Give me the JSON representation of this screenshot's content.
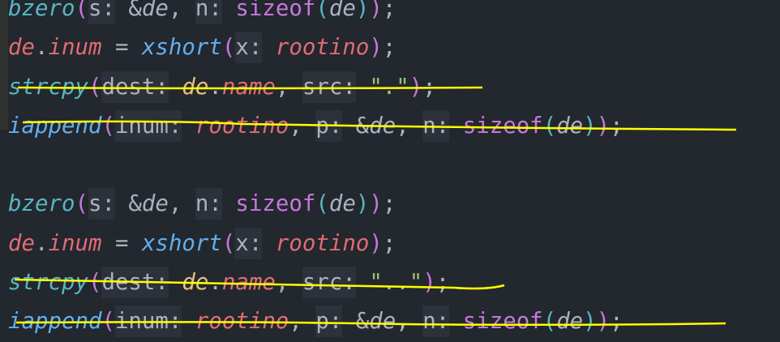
{
  "colors": {
    "background": "#23272e",
    "variable": "#e06c75",
    "function": "#61afef",
    "builtin_function": "#56b6c2",
    "paren": "#c678dd",
    "member_base": "#e5c07b",
    "string": "#98c379",
    "plain": "#abb2bf",
    "hint_bg": "#2c313a",
    "annotation": "#ffff00"
  },
  "lines": [
    [
      {
        "t": "bzero",
        "c": "builtin_function",
        "i": true
      },
      {
        "t": "(",
        "c": "paren"
      },
      {
        "t": "s:",
        "h": true
      },
      {
        "t": " &"
      },
      {
        "t": "de",
        "i": true
      },
      {
        "t": ", "
      },
      {
        "t": "n:",
        "h": true
      },
      {
        "t": " "
      },
      {
        "t": "sizeof",
        "c": "paren"
      },
      {
        "t": "(",
        "c": "builtin_function"
      },
      {
        "t": "de",
        "i": true
      },
      {
        "t": ")",
        "c": "builtin_function"
      },
      {
        "t": ")",
        "c": "paren"
      },
      {
        "t": ";"
      }
    ],
    [
      {
        "t": "de",
        "c": "variable",
        "i": true
      },
      {
        "t": "."
      },
      {
        "t": "inum",
        "c": "variable",
        "i": true
      },
      {
        "t": " = "
      },
      {
        "t": "xshort",
        "c": "function",
        "i": true
      },
      {
        "t": "(",
        "c": "paren"
      },
      {
        "t": "x:",
        "h": true
      },
      {
        "t": " "
      },
      {
        "t": "rootino",
        "c": "variable",
        "i": true
      },
      {
        "t": ")",
        "c": "paren"
      },
      {
        "t": ";"
      }
    ],
    [
      {
        "t": "strcpy",
        "c": "builtin_function",
        "i": true
      },
      {
        "t": "(",
        "c": "paren"
      },
      {
        "t": "dest:",
        "h": true
      },
      {
        "t": " "
      },
      {
        "t": "de",
        "c": "member_base",
        "i": true
      },
      {
        "t": "."
      },
      {
        "t": "name",
        "c": "variable",
        "i": true
      },
      {
        "t": ", "
      },
      {
        "t": "src:",
        "h": true
      },
      {
        "t": " "
      },
      {
        "t": "\".\"",
        "c": "string"
      },
      {
        "t": ")",
        "c": "paren"
      },
      {
        "t": ";"
      }
    ],
    [
      {
        "t": "iappend",
        "c": "function",
        "i": true
      },
      {
        "t": "(",
        "c": "paren"
      },
      {
        "t": "inum:",
        "h": true
      },
      {
        "t": " "
      },
      {
        "t": "rootino",
        "c": "variable",
        "i": true
      },
      {
        "t": ", "
      },
      {
        "t": "p:",
        "h": true
      },
      {
        "t": " &"
      },
      {
        "t": "de",
        "i": true
      },
      {
        "t": ", "
      },
      {
        "t": "n:",
        "h": true
      },
      {
        "t": " "
      },
      {
        "t": "sizeof",
        "c": "paren"
      },
      {
        "t": "(",
        "c": "builtin_function"
      },
      {
        "t": "de",
        "i": true
      },
      {
        "t": ")",
        "c": "builtin_function"
      },
      {
        "t": ")",
        "c": "paren"
      },
      {
        "t": ";"
      }
    ],
    [],
    [
      {
        "t": "bzero",
        "c": "builtin_function",
        "i": true
      },
      {
        "t": "(",
        "c": "paren"
      },
      {
        "t": "s:",
        "h": true
      },
      {
        "t": " &"
      },
      {
        "t": "de",
        "i": true
      },
      {
        "t": ", "
      },
      {
        "t": "n:",
        "h": true
      },
      {
        "t": " "
      },
      {
        "t": "sizeof",
        "c": "paren"
      },
      {
        "t": "(",
        "c": "builtin_function"
      },
      {
        "t": "de",
        "i": true
      },
      {
        "t": ")",
        "c": "builtin_function"
      },
      {
        "t": ")",
        "c": "paren"
      },
      {
        "t": ";"
      }
    ],
    [
      {
        "t": "de",
        "c": "variable",
        "i": true
      },
      {
        "t": "."
      },
      {
        "t": "inum",
        "c": "variable",
        "i": true
      },
      {
        "t": " = "
      },
      {
        "t": "xshort",
        "c": "function",
        "i": true
      },
      {
        "t": "(",
        "c": "paren"
      },
      {
        "t": "x:",
        "h": true
      },
      {
        "t": " "
      },
      {
        "t": "rootino",
        "c": "variable",
        "i": true
      },
      {
        "t": ")",
        "c": "paren"
      },
      {
        "t": ";"
      }
    ],
    [
      {
        "t": "strcpy",
        "c": "builtin_function",
        "i": true
      },
      {
        "t": "(",
        "c": "paren"
      },
      {
        "t": "dest:",
        "h": true
      },
      {
        "t": " "
      },
      {
        "t": "de",
        "c": "member_base",
        "i": true
      },
      {
        "t": "."
      },
      {
        "t": "name",
        "c": "variable",
        "i": true
      },
      {
        "t": ", "
      },
      {
        "t": "src:",
        "h": true
      },
      {
        "t": " "
      },
      {
        "t": "\"..\"",
        "c": "string"
      },
      {
        "t": ")",
        "c": "paren"
      },
      {
        "t": ";"
      }
    ],
    [
      {
        "t": "iappend",
        "c": "function",
        "i": true
      },
      {
        "t": "(",
        "c": "paren"
      },
      {
        "t": "inum:",
        "h": true
      },
      {
        "t": " "
      },
      {
        "t": "rootino",
        "c": "variable",
        "i": true
      },
      {
        "t": ", "
      },
      {
        "t": "p:",
        "h": true
      },
      {
        "t": " &"
      },
      {
        "t": "de",
        "i": true
      },
      {
        "t": ", "
      },
      {
        "t": "n:",
        "h": true
      },
      {
        "t": " "
      },
      {
        "t": "sizeof",
        "c": "paren"
      },
      {
        "t": "(",
        "c": "builtin_function"
      },
      {
        "t": "de",
        "i": true
      },
      {
        "t": ")",
        "c": "builtin_function"
      },
      {
        "t": ")",
        "c": "paren"
      },
      {
        "t": ";"
      }
    ]
  ]
}
